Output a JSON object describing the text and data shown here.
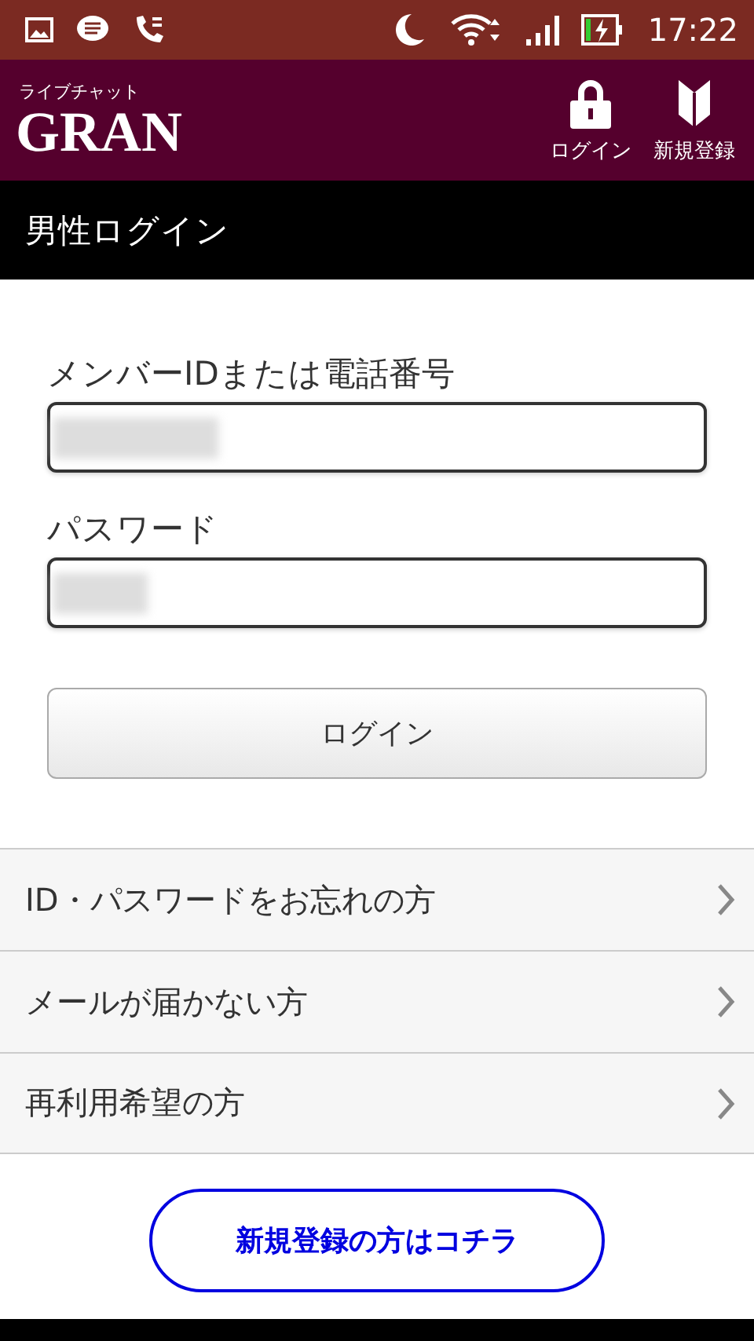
{
  "status_bar": {
    "time": "17:22"
  },
  "header": {
    "logo_subtitle": "ライブチャット",
    "logo": "GRAN",
    "actions": [
      {
        "kind": "lock",
        "label": "ログイン"
      },
      {
        "kind": "leaf",
        "label": "新規登録"
      }
    ]
  },
  "page_title": "男性ログイン",
  "form": {
    "fields": [
      {
        "kind": "text",
        "label": "メンバーIDまたは電話番号"
      },
      {
        "kind": "password",
        "label": "パスワード"
      }
    ],
    "submit": "ログイン"
  },
  "links": [
    {
      "label": "ID・パスワードをお忘れの方"
    },
    {
      "label": "メールが届かない方"
    },
    {
      "label": "再利用希望の方"
    }
  ],
  "register_button": "新規登録の方はコチラ"
}
